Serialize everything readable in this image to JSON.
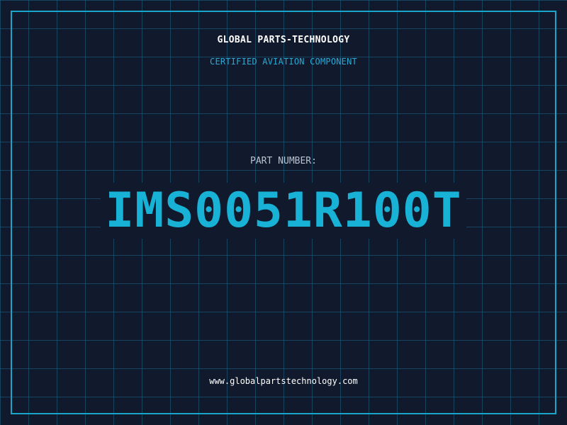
{
  "header": {
    "brand": "GLOBAL PARTS-TECHNOLOGY",
    "tagline": "CERTIFIED AVIATION COMPONENT"
  },
  "part": {
    "label": "PART NUMBER:",
    "number": "IMS0051R100T"
  },
  "footer": {
    "website": "www.globalpartstechnology.com"
  },
  "colors": {
    "background": "#111a2c",
    "grid": "#1c78a0",
    "frame": "#1aa6c8",
    "accent": "#18b2d6",
    "text": "#ffffff"
  }
}
